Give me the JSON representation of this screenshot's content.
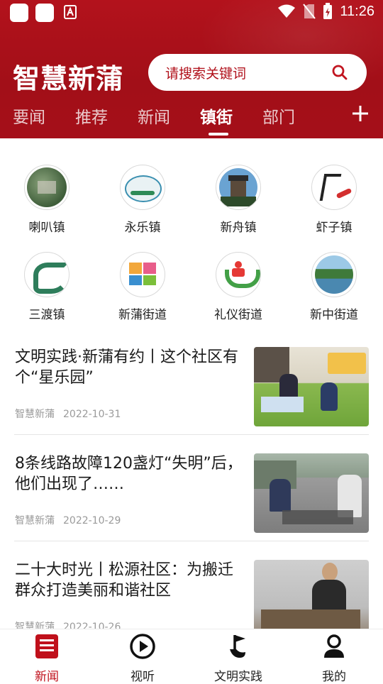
{
  "status": {
    "time": "11:26"
  },
  "header": {
    "brand": "智慧新蒲",
    "search_placeholder": "请搜索关键词",
    "tabs": [
      "要闻",
      "推荐",
      "新闻",
      "镇街",
      "部门"
    ],
    "active_tab": "镇街"
  },
  "towns": [
    {
      "name": "喇叭镇",
      "icon": "aerial-town-photo"
    },
    {
      "name": "永乐镇",
      "icon": "landscape-emblem"
    },
    {
      "name": "新舟镇",
      "icon": "pagoda-building"
    },
    {
      "name": "虾子镇",
      "icon": "calligraphy-pepper"
    },
    {
      "name": "三渡镇",
      "icon": "green-calligraphy"
    },
    {
      "name": "新蒲街道",
      "icon": "colorful-text-emblem"
    },
    {
      "name": "礼仪街道",
      "icon": "hands-figure-emblem"
    },
    {
      "name": "新中街道",
      "icon": "lake-park-photo"
    }
  ],
  "news": [
    {
      "title": "文明实践·新蒲有约丨这个社区有个“星乐园”",
      "source": "智慧新蒲",
      "date": "2022-10-31",
      "thumb": "children-classroom-photo"
    },
    {
      "title": "8条线路故障120盏灯“失明”后，他们出现了……",
      "source": "智慧新蒲",
      "date": "2022-10-29",
      "thumb": "street-workers-photo"
    },
    {
      "title": "二十大时光丨松源社区：为搬迁群众打造美丽和谐社区",
      "source": "智慧新蒲",
      "date": "2022-10-26",
      "thumb": "man-at-workshop-photo"
    }
  ],
  "tabbar": [
    {
      "label": "新闻",
      "icon": "news-icon",
      "active": true
    },
    {
      "label": "视听",
      "icon": "play-icon",
      "active": false
    },
    {
      "label": "文明实践",
      "icon": "flag-hand-icon",
      "active": false
    },
    {
      "label": "我的",
      "icon": "user-icon",
      "active": false
    }
  ],
  "colors": {
    "primary": "#a51119",
    "active_tab": "#c0101b"
  }
}
